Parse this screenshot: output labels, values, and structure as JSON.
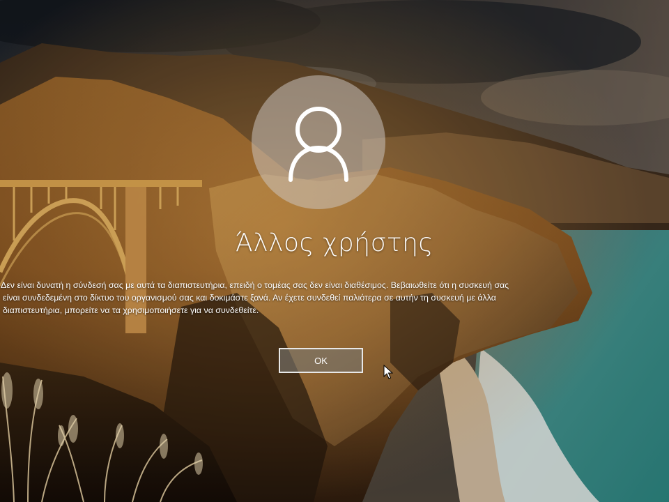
{
  "login": {
    "username": "Άλλος χρήστης",
    "message_lines": [
      "Δεν είναι δυνατή η σύνδεσή σας με αυτά τα διαπιστευτήρια, επειδή ο τομέας σας δεν είναι διαθέσιμος. Βεβαιωθείτε ότι η συσκευή σας",
      "είναι συνδεδεμένη στο δίκτυο του οργανισμού σας και δοκιμάστε ξανά. Αν έχετε συνδεθεί παλιότερα σε αυτήν τη συσκευή με άλλα",
      "διαπιστευτήρια, μπορείτε να τα χρησιμοποιήσετε για να συνδεθείτε."
    ],
    "ok_label": "OK"
  },
  "icons": {
    "avatar": "user-silhouette-icon",
    "cursor": "mouse-pointer-icon"
  },
  "colors": {
    "text": "#ffffff",
    "button_border": "#e8e8e8"
  }
}
